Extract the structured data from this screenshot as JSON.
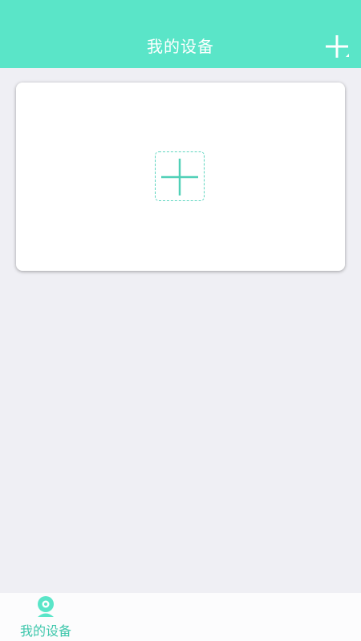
{
  "header": {
    "title": "我的设备",
    "add_icon": "plus-icon"
  },
  "device_card": {
    "add_icon": "dashed-plus-icon"
  },
  "tabbar": {
    "tabs": [
      {
        "label": "我的设备",
        "icon": "camera-icon",
        "active": true
      }
    ]
  },
  "colors": {
    "accent": "#5ae5c8",
    "tab_active": "#3fc7ac",
    "background": "#efeff4"
  }
}
